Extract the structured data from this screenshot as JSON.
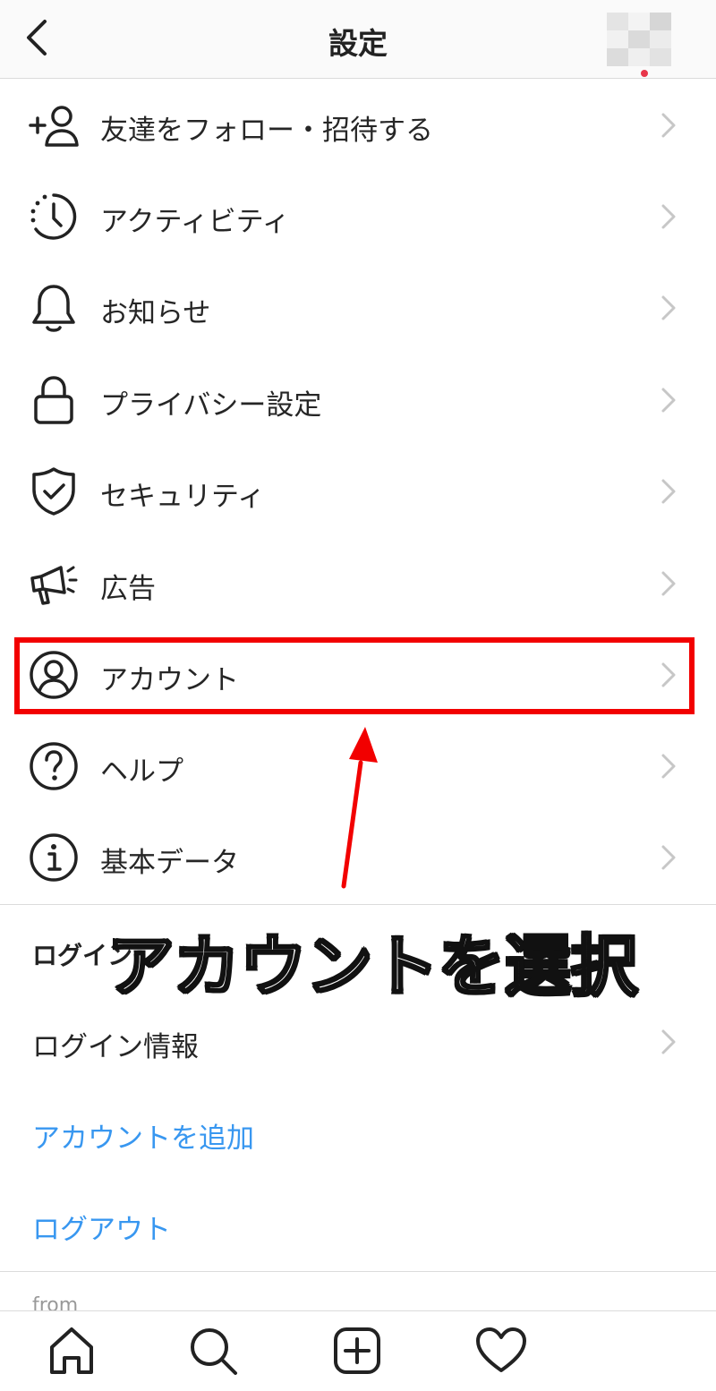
{
  "header": {
    "title": "設定",
    "back_icon": "chevron-left-icon"
  },
  "menu": {
    "items": [
      {
        "label": "友達をフォロー・招待する",
        "icon": "add-person-icon"
      },
      {
        "label": "アクティビティ",
        "icon": "activity-clock-icon"
      },
      {
        "label": "お知らせ",
        "icon": "bell-icon"
      },
      {
        "label": "プライバシー設定",
        "icon": "lock-icon"
      },
      {
        "label": "セキュリティ",
        "icon": "shield-check-icon"
      },
      {
        "label": "広告",
        "icon": "megaphone-icon"
      },
      {
        "label": "アカウント",
        "icon": "account-circle-icon"
      },
      {
        "label": "ヘルプ",
        "icon": "help-circle-icon"
      },
      {
        "label": "基本データ",
        "icon": "info-circle-icon"
      }
    ]
  },
  "login_section": {
    "title": "ログイン",
    "login_info": "ログイン情報",
    "add_account": "アカウントを追加",
    "logout": "ログアウト"
  },
  "footer": {
    "from_text": "from"
  },
  "tabbar": {
    "items": [
      "home-icon",
      "search-icon",
      "new-post-icon",
      "heart-icon",
      "profile-avatar"
    ]
  },
  "annotation": {
    "text": "アカウントを選択",
    "highlight_color": "#f20000"
  },
  "colors": {
    "link_blue": "#3897f0",
    "text": "#262626",
    "chevron": "#c7c7c7"
  }
}
